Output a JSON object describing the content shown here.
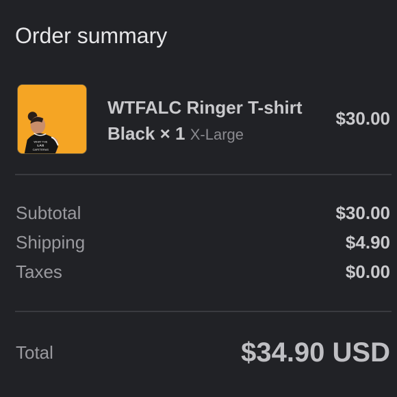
{
  "header": {
    "title": "Order summary"
  },
  "line_item": {
    "name": "WTFALC Ringer T-shirt Black",
    "quantity": "× 1",
    "variant": "X-Large",
    "price": "$30.00",
    "thumbnail_shirt_text": [
      "WHAT THE",
      "LAS",
      "CAFETERAS"
    ]
  },
  "totals": {
    "subtotal_label": "Subtotal",
    "subtotal_value": "$30.00",
    "shipping_label": "Shipping",
    "shipping_value": "$4.90",
    "taxes_label": "Taxes",
    "taxes_value": "$0.00",
    "total_label": "Total",
    "total_value": "$34.90 USD"
  },
  "colors": {
    "background": "#212226",
    "thumbnail_background": "#f5a524",
    "divider": "#3a3b40"
  }
}
